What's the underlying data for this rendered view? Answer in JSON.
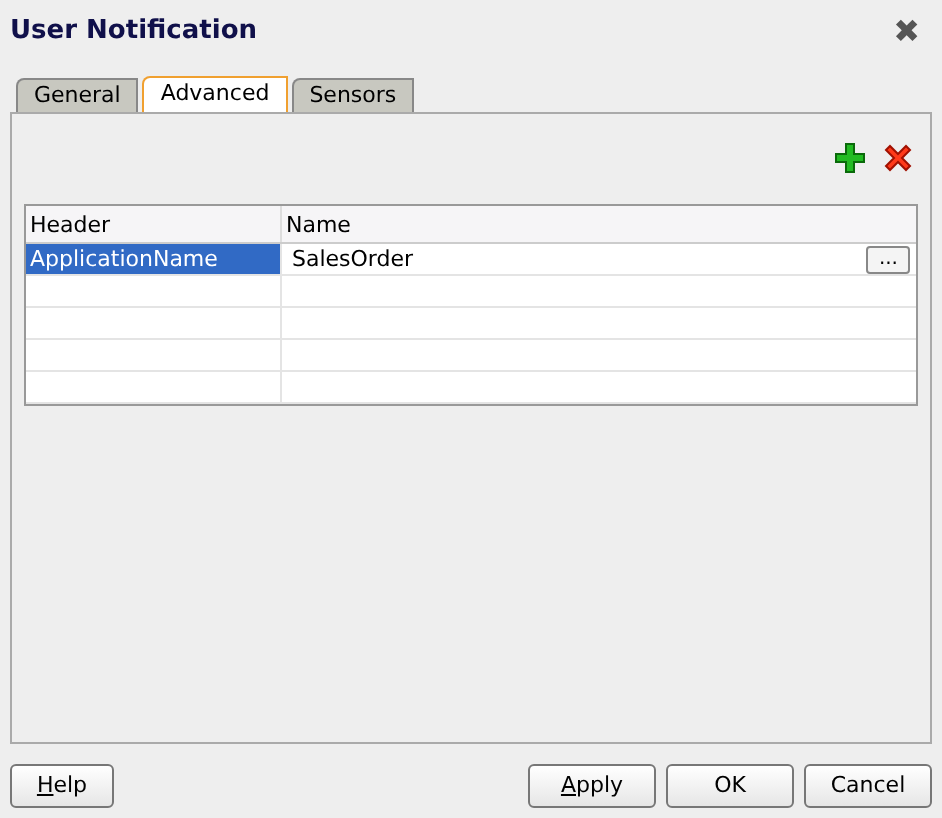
{
  "window": {
    "title": "User Notification",
    "close": "✖"
  },
  "tabs": [
    {
      "label": "General",
      "selected": false
    },
    {
      "label": "Advanced",
      "selected": true
    },
    {
      "label": "Sensors",
      "selected": false
    }
  ],
  "toolbar": [
    {
      "kind": "add"
    },
    {
      "kind": "delete"
    }
  ],
  "table": {
    "columns": [
      "Header",
      "Name"
    ],
    "rows": [
      {
        "cells": [
          "ApplicationName",
          "SalesOrder"
        ],
        "selected": true,
        "browse": "..."
      },
      {
        "cells": [],
        "selected": false
      },
      {
        "cells": [],
        "selected": false
      },
      {
        "cells": [],
        "selected": false
      },
      {
        "cells": [],
        "selected": false
      }
    ]
  },
  "buttons": [
    {
      "label": "Help",
      "underline_first": true
    },
    {
      "label": "Apply",
      "underline_first": true
    },
    {
      "label": "OK",
      "underline_first": false
    },
    {
      "label": "Cancel",
      "underline_first": false
    }
  ]
}
